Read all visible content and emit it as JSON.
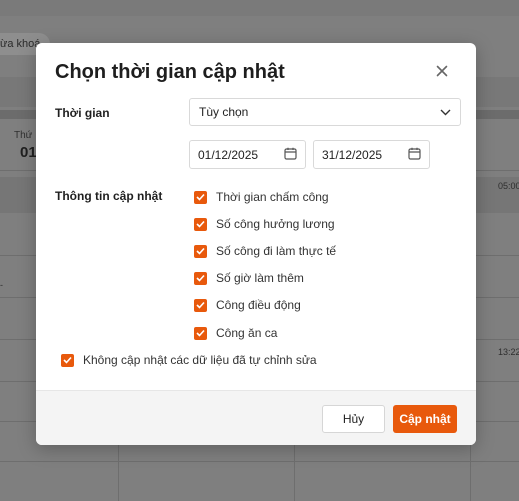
{
  "background": {
    "chip_label": "ừa khoá",
    "day_header": "Thứ",
    "day_number": "01",
    "time_a": "05:00",
    "time_b": "13:22",
    "edge_mark": "-"
  },
  "modal": {
    "title": "Chọn thời gian cập nhật",
    "time_label": "Thời gian",
    "time_select_value": "Tùy chọn",
    "date_from": "01/12/2025",
    "date_to": "31/12/2025",
    "update_info_label": "Thông tin cập nhật",
    "update_options": [
      {
        "label": "Thời gian chấm công",
        "checked": true
      },
      {
        "label": "Số công hưởng lương",
        "checked": true
      },
      {
        "label": "Số công đi làm thực tế",
        "checked": true
      },
      {
        "label": "Số giờ làm thêm",
        "checked": true
      },
      {
        "label": "Công điều động",
        "checked": true
      },
      {
        "label": "Công ăn ca",
        "checked": true
      }
    ],
    "skip_edited": {
      "label": "Không cập nhật các dữ liệu đã tự chỉnh sửa",
      "checked": true
    },
    "cancel_label": "Hủy",
    "confirm_label": "Cập nhật"
  },
  "colors": {
    "accent": "#e8590c",
    "overlay": "#7f7f7f"
  },
  "icons": {
    "close": "close-icon",
    "dropdown": "chevron-down-icon",
    "calendar": "calendar-icon",
    "check": "check-icon"
  }
}
